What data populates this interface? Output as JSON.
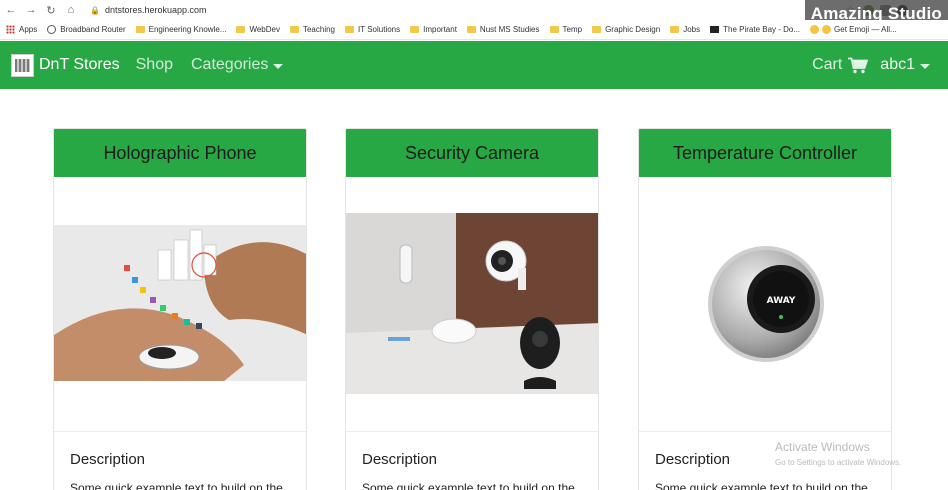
{
  "browser": {
    "url": "dntstores.herokuapp.com",
    "watermark": "Amazing Studio",
    "bookmarks": [
      {
        "label": "Apps",
        "icon": "apps-grid-icon"
      },
      {
        "label": "Broadband Router",
        "icon": "globe-icon"
      },
      {
        "label": "Engineering Knowle...",
        "icon": "folder-icon"
      },
      {
        "label": "WebDev",
        "icon": "folder-icon"
      },
      {
        "label": "Teaching",
        "icon": "folder-icon"
      },
      {
        "label": "IT Solutions",
        "icon": "folder-icon"
      },
      {
        "label": "Important",
        "icon": "folder-icon"
      },
      {
        "label": "Nust MS Studies",
        "icon": "folder-icon"
      },
      {
        "label": "Temp",
        "icon": "folder-icon"
      },
      {
        "label": "Graphic Design",
        "icon": "folder-icon"
      },
      {
        "label": "Jobs",
        "icon": "folder-icon"
      },
      {
        "label": "The Pirate Bay - Do...",
        "icon": "tv-icon"
      },
      {
        "label": "Get Emoji — All...",
        "icon": "emoji-icon"
      }
    ]
  },
  "navbar": {
    "brand": "DnT Stores",
    "shop": "Shop",
    "categories": "Categories",
    "cart": "Cart",
    "user": "abc1",
    "color": "#28a745"
  },
  "products": [
    {
      "title": "Holographic Phone",
      "desc_title": "Description",
      "desc_text": "Some quick example text to build on the"
    },
    {
      "title": "Security Camera",
      "desc_title": "Description",
      "desc_text": "Some quick example text to build on the"
    },
    {
      "title": "Temperature Controller",
      "desc_title": "Description",
      "desc_text": "Some quick example text to build on the"
    }
  ],
  "os_watermark": {
    "line1": "Activate Windows",
    "line2": "Go to Settings to activate Windows."
  }
}
